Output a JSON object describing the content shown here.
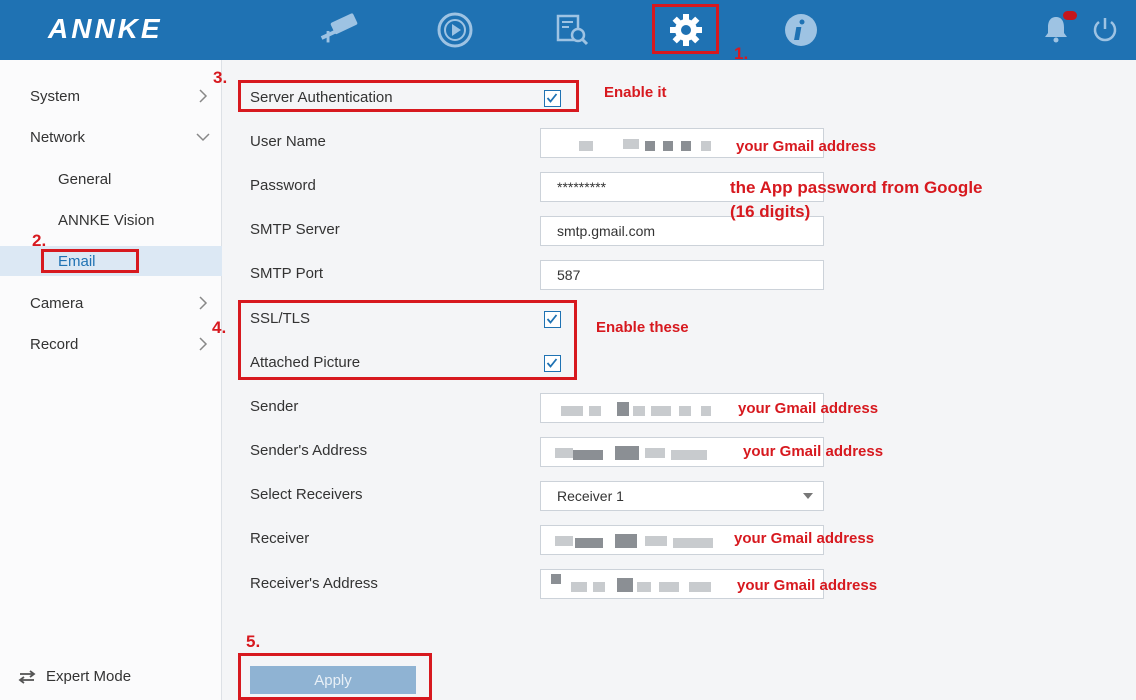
{
  "app": {
    "logo": "ANNKE"
  },
  "topnav": {
    "items": [
      {
        "icon": "camera-icon"
      },
      {
        "icon": "playback-icon"
      },
      {
        "icon": "search-icon"
      },
      {
        "icon": "settings-icon",
        "active": true
      },
      {
        "icon": "info-icon"
      }
    ],
    "right": [
      {
        "icon": "bell-icon"
      },
      {
        "icon": "power-icon"
      }
    ]
  },
  "sidebar": {
    "items": [
      {
        "label": "System"
      },
      {
        "label": "Network"
      },
      {
        "label": "General"
      },
      {
        "label": "ANNKE Vision"
      },
      {
        "label": "Email",
        "active": true
      },
      {
        "label": "Camera"
      },
      {
        "label": "Record"
      }
    ],
    "expert_mode": "Expert Mode"
  },
  "form": {
    "server_auth": {
      "label": "Server Authentication",
      "checked": true
    },
    "user_name": {
      "label": "User Name"
    },
    "password": {
      "label": "Password",
      "value": "*********"
    },
    "smtp_server": {
      "label": "SMTP Server",
      "value": "smtp.gmail.com"
    },
    "smtp_port": {
      "label": "SMTP Port",
      "value": "587"
    },
    "ssl_tls": {
      "label": "SSL/TLS",
      "checked": true
    },
    "attached_picture": {
      "label": "Attached Picture",
      "checked": true
    },
    "sender": {
      "label": "Sender"
    },
    "senders_address": {
      "label": "Sender's Address"
    },
    "select_receivers": {
      "label": "Select Receivers",
      "value": "Receiver 1"
    },
    "receiver": {
      "label": "Receiver"
    },
    "receivers_address": {
      "label": "Receiver's Address"
    },
    "apply": "Apply"
  },
  "annotations": {
    "step1": "1.",
    "step2": "2.",
    "step3": "3.",
    "step4": "4.",
    "step5": "5.",
    "enable_it": "Enable  it",
    "enable_these": "Enable these",
    "gmail_user": "your Gmail address",
    "app_password_line1": "the App password from Google",
    "app_password_line2": "(16 digits)",
    "gmail_sender": "your Gmail address",
    "gmail_sender_addr": "your Gmail address",
    "gmail_receiver": "your Gmail address",
    "gmail_receiver_addr": "your Gmail address",
    "color": "#d7191f"
  },
  "colors": {
    "topbar": "#1f72b3",
    "accent": "#1f72b3"
  }
}
